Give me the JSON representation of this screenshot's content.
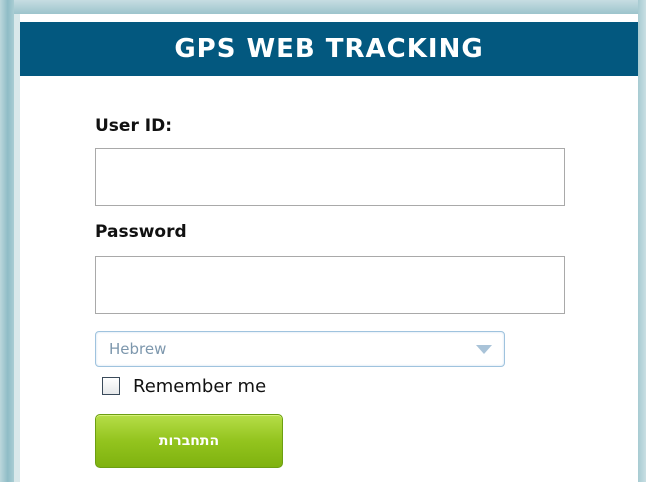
{
  "header": {
    "title": "GPS WEB TRACKING"
  },
  "form": {
    "user_id_label": "User ID:",
    "user_id_value": "",
    "password_label": "Password",
    "password_value": "",
    "language_selected": "Hebrew",
    "remember_label": "Remember me",
    "remember_checked": false,
    "login_label": "התחברות"
  },
  "icons": {
    "dropdown": "chevron-down-icon",
    "checkbox": "checkbox-unchecked"
  },
  "colors": {
    "header_bg": "#03587f",
    "button_green": "#93c41e",
    "select_text": "#7d97ad"
  }
}
